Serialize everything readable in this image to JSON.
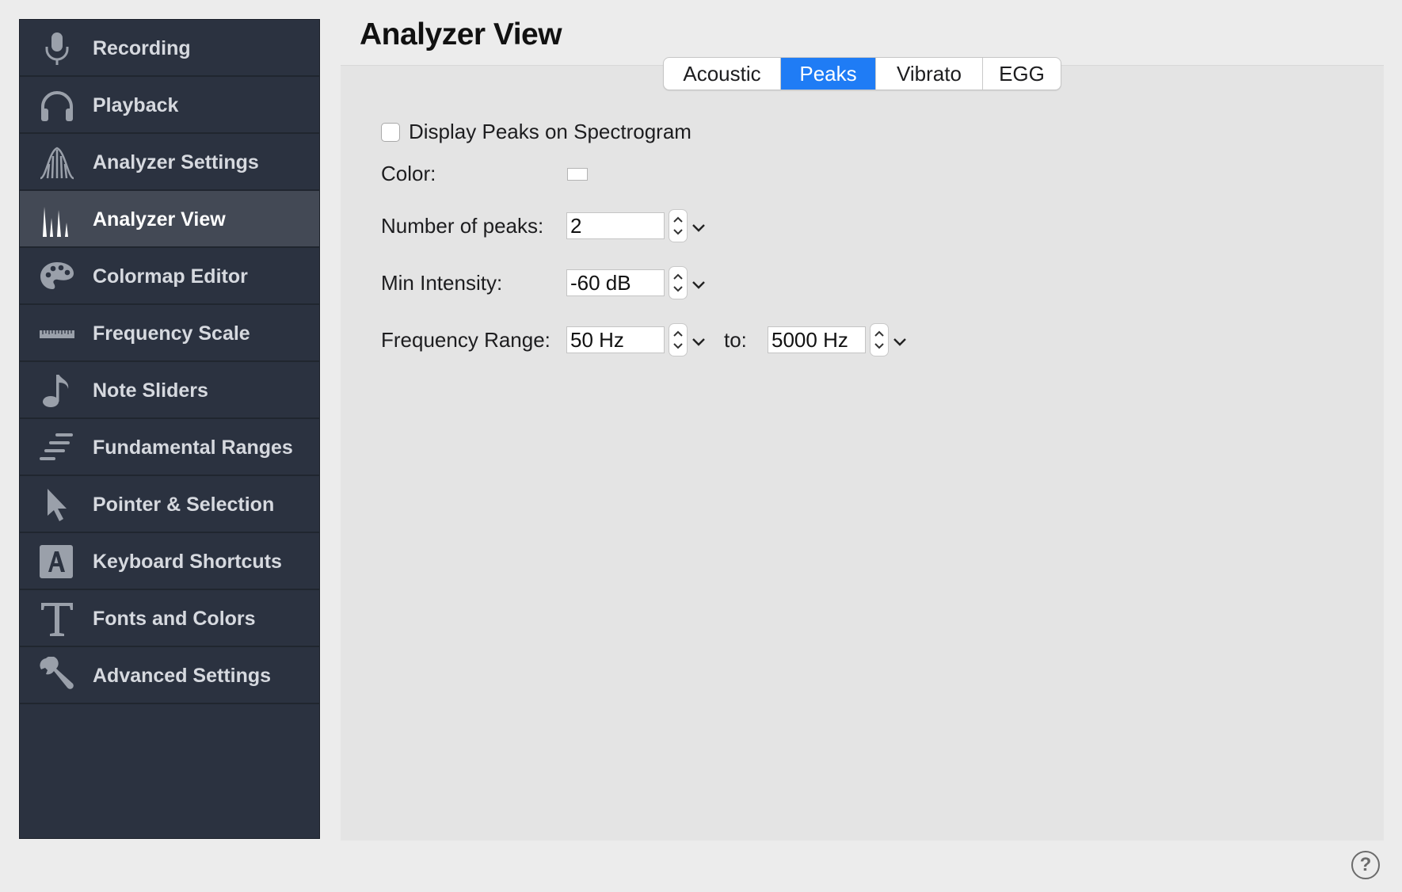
{
  "sidebar": {
    "items": [
      {
        "label": "Recording",
        "icon": "microphone-icon"
      },
      {
        "label": "Playback",
        "icon": "headphones-icon"
      },
      {
        "label": "Analyzer Settings",
        "icon": "analyzer-settings-icon"
      },
      {
        "label": "Analyzer View",
        "icon": "peaks-icon",
        "active": true
      },
      {
        "label": "Colormap Editor",
        "icon": "palette-icon"
      },
      {
        "label": "Frequency Scale",
        "icon": "ruler-icon"
      },
      {
        "label": "Note Sliders",
        "icon": "music-note-icon"
      },
      {
        "label": "Fundamental Ranges",
        "icon": "ranges-icon"
      },
      {
        "label": "Pointer & Selection",
        "icon": "pointer-icon"
      },
      {
        "label": "Keyboard Shortcuts",
        "icon": "keyboard-key-icon"
      },
      {
        "label": "Fonts and Colors",
        "icon": "typeface-icon"
      },
      {
        "label": "Advanced Settings",
        "icon": "wrench-icon"
      }
    ]
  },
  "main": {
    "title": "Analyzer View",
    "tabs": [
      {
        "label": "Acoustic"
      },
      {
        "label": "Peaks",
        "active": true
      },
      {
        "label": "Vibrato"
      },
      {
        "label": "EGG"
      }
    ],
    "peaks": {
      "display_checkbox_label": "Display Peaks on Spectrogram",
      "display_checked": false,
      "color_label": "Color:",
      "color_value": "#ffffff",
      "num_peaks_label": "Number of peaks:",
      "num_peaks_value": "2",
      "min_intensity_label": "Min Intensity:",
      "min_intensity_value": "-60 dB",
      "freq_range_label": "Frequency Range:",
      "freq_from_value": "50 Hz",
      "to_label": "to:",
      "freq_to_value": "5000 Hz"
    }
  },
  "help": {
    "label": "?"
  },
  "colors": {
    "sidebar_bg": "#2b3240",
    "sidebar_active": "#434955",
    "accent": "#1f7cf5",
    "window_bg": "#ececec",
    "panel_bg": "#e4e4e4"
  }
}
